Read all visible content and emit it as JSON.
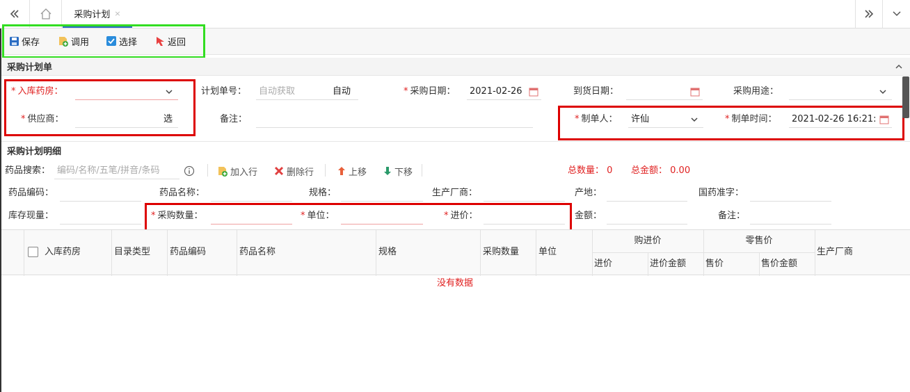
{
  "tabbar": {
    "tab_label": "采购计划",
    "tab_close": "×",
    "left_icon": "double-chevron-left-icon",
    "home_icon": "home-icon",
    "right_icon": "double-chevron-right-icon",
    "menu_icon": "chevron-down-icon"
  },
  "toolbar": {
    "save": "保存",
    "invoke": "调用",
    "select": "选择",
    "back": "返回"
  },
  "plan_form": {
    "title": "采购计划单",
    "warehouse_label": "入库药房：",
    "warehouse_value": "",
    "plan_no_label": "计划单号：",
    "plan_no_placeholder": "自动获取",
    "plan_no_mode": "自动",
    "purchase_date_label": "采购日期：",
    "purchase_date_value": "2021-02-26",
    "arrival_date_label": "到货日期：",
    "arrival_date_value": "",
    "purpose_label": "采购用途：",
    "purpose_value": "",
    "supplier_label": "供应商：",
    "supplier_button": "选",
    "remark_label": "备注：",
    "remark_value": "",
    "creator_label": "制单人：",
    "creator_value": "许仙",
    "create_time_label": "制单时间：",
    "create_time_value": "2021-02-26 16:21:"
  },
  "detail": {
    "title": "采购计划明细",
    "search_label": "药品搜索：",
    "search_placeholder": "编码/名称/五笔/拼音/条码",
    "add_row": "加入行",
    "delete_row": "删除行",
    "move_up": "上移",
    "move_down": "下移",
    "total_qty_label": "总数量：",
    "total_qty_value": "0",
    "total_amount_label": "总金额：",
    "total_amount_value": "0.00",
    "code_label": "药品编码：",
    "name_label": "药品名称：",
    "spec_label": "规格：",
    "maker_label": "生产厂商：",
    "origin_label": "产地：",
    "approval_label": "国药准字：",
    "stock_label": "库存现量：",
    "qty_label": "采购数量：",
    "unit_label": "单位：",
    "price_label": "进价：",
    "amount_label": "金额：",
    "remark_label": "备注："
  },
  "grid": {
    "columns": [
      "入库药房",
      "目录类型",
      "药品编码",
      "药品名称",
      "规格",
      "采购数量",
      "单位"
    ],
    "group_purchase": "购进价",
    "group_retail": "零售价",
    "sub_cols": [
      "进价",
      "进价金额",
      "售价",
      "售价金额"
    ],
    "maker_col": "生产厂商",
    "empty_text": "没有数据"
  },
  "colors": {
    "accent": "#2a6cc2",
    "required": "#e02020",
    "highlight_red": "#dd0000",
    "highlight_green": "#33dd22"
  }
}
